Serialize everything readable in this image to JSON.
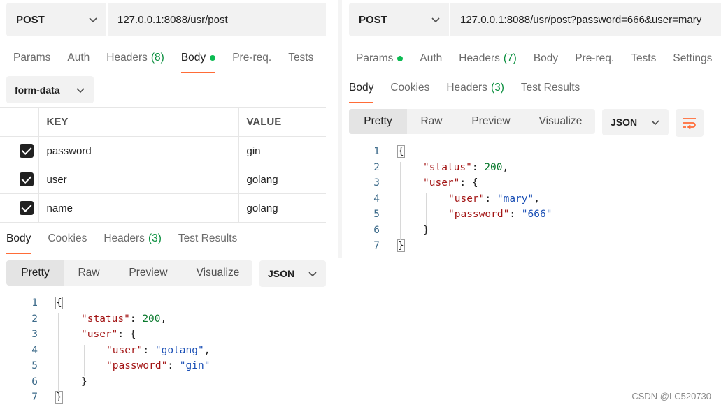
{
  "left": {
    "method": "POST",
    "url": "127.0.0.1:8088/usr/post",
    "request_tabs": [
      {
        "label": "Params"
      },
      {
        "label": "Auth"
      },
      {
        "label": "Headers",
        "count": "(8)"
      },
      {
        "label": "Body",
        "active": true,
        "dot": true
      },
      {
        "label": "Pre-req."
      },
      {
        "label": "Tests"
      }
    ],
    "body_type": "form-data",
    "table": {
      "headers": [
        "KEY",
        "VALUE"
      ],
      "rows": [
        {
          "checked": true,
          "key": "password",
          "value": "gin"
        },
        {
          "checked": true,
          "key": "user",
          "value": "golang"
        },
        {
          "checked": true,
          "key": "name",
          "value": "golang"
        }
      ]
    },
    "response_tabs": [
      {
        "label": "Body",
        "active": true
      },
      {
        "label": "Cookies"
      },
      {
        "label": "Headers",
        "count": "(3)"
      },
      {
        "label": "Test Results"
      }
    ],
    "views": [
      "Pretty",
      "Raw",
      "Preview",
      "Visualize"
    ],
    "format": "JSON",
    "response_lines": [
      {
        "n": "1",
        "text": "{"
      },
      {
        "n": "2",
        "key": "\"status\"",
        "value": "200",
        "type": "num",
        "tail": ","
      },
      {
        "n": "3",
        "key": "\"user\"",
        "value": "{",
        "type": "plain"
      },
      {
        "n": "4",
        "key": "\"user\"",
        "value": "\"golang\"",
        "type": "str",
        "tail": ","
      },
      {
        "n": "5",
        "key": "\"password\"",
        "value": "\"gin\"",
        "type": "str"
      },
      {
        "n": "6",
        "text": "}"
      },
      {
        "n": "7",
        "text": "}"
      }
    ]
  },
  "right": {
    "method": "POST",
    "url": "127.0.0.1:8088/usr/post?password=666&user=mary",
    "request_tabs": [
      {
        "label": "Params",
        "dot": true
      },
      {
        "label": "Auth"
      },
      {
        "label": "Headers",
        "count": "(7)"
      },
      {
        "label": "Body"
      },
      {
        "label": "Pre-req."
      },
      {
        "label": "Tests"
      },
      {
        "label": "Settings"
      }
    ],
    "response_tabs": [
      {
        "label": "Body",
        "active": true
      },
      {
        "label": "Cookies"
      },
      {
        "label": "Headers",
        "count": "(3)"
      },
      {
        "label": "Test Results"
      }
    ],
    "views": [
      "Pretty",
      "Raw",
      "Preview",
      "Visualize"
    ],
    "format": "JSON",
    "response_lines": [
      {
        "n": "1",
        "text": "{"
      },
      {
        "n": "2",
        "key": "\"status\"",
        "value": "200",
        "type": "num",
        "tail": ","
      },
      {
        "n": "3",
        "key": "\"user\"",
        "value": "{",
        "type": "plain"
      },
      {
        "n": "4",
        "key": "\"user\"",
        "value": "\"mary\"",
        "type": "str",
        "tail": ","
      },
      {
        "n": "5",
        "key": "\"password\"",
        "value": "\"666\"",
        "type": "str"
      },
      {
        "n": "6",
        "text": "}"
      },
      {
        "n": "7",
        "text": "}"
      }
    ]
  },
  "watermark": "CSDN @LC520730",
  "colors": {
    "accent": "#ff6c37",
    "status_dot": "#0cbb52",
    "count": "#0a8f3e"
  }
}
